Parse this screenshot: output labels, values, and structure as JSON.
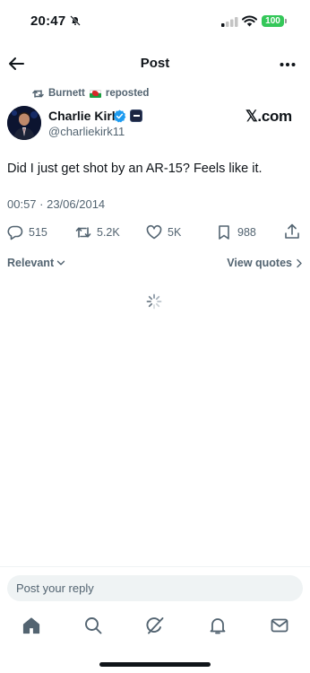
{
  "status_bar": {
    "time": "20:47",
    "battery": "100"
  },
  "nav": {
    "title": "Post"
  },
  "repost": {
    "reposter": "Burnett",
    "action": "reposted"
  },
  "author": {
    "name": "Charlie Kirk",
    "handle": "@charliekirk11"
  },
  "watermark": "𝕏.com",
  "tweet": {
    "text": "Did I just get shot by an AR-15? Feels like it.",
    "timestamp": "00:57 · 23/06/2014"
  },
  "stats": {
    "replies": "515",
    "reposts": "5.2K",
    "likes": "5K",
    "bookmarks": "988"
  },
  "sort": {
    "relevant_label": "Relevant",
    "view_quotes_label": "View quotes"
  },
  "reply": {
    "placeholder": "Post your reply"
  },
  "tabs": [
    "home-icon",
    "search-icon",
    "grok-icon",
    "notifications-icon",
    "messages-icon"
  ],
  "colors": {
    "text": "#0f1419",
    "muted": "#536471",
    "verified": "#1d9bf0",
    "battery": "#34c759"
  }
}
